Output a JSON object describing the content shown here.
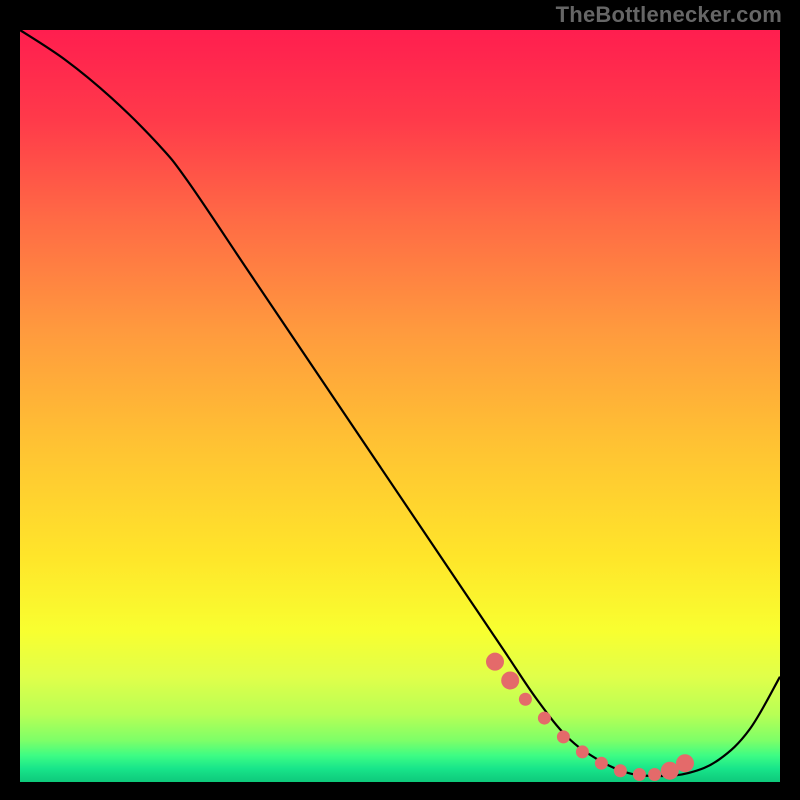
{
  "attribution": "TheBottlenecker.com",
  "chart_data": {
    "type": "line",
    "title": "",
    "xlabel": "",
    "ylabel": "",
    "xlim": [
      0,
      100
    ],
    "ylim": [
      0,
      100
    ],
    "series": [
      {
        "name": "curve",
        "x": [
          0,
          6,
          12,
          18,
          22,
          30,
          38,
          46,
          54,
          60,
          64,
          68,
          72,
          76,
          80,
          84,
          88,
          92,
          96,
          100
        ],
        "y": [
          100,
          96,
          91,
          85,
          80,
          68,
          56,
          44,
          32,
          23,
          17,
          11,
          6,
          3,
          1.2,
          0.8,
          1.2,
          3,
          7,
          14
        ]
      }
    ],
    "markers": {
      "x": [
        62.5,
        64.5,
        66.5,
        69,
        71.5,
        74,
        76.5,
        79,
        81.5,
        83.5,
        85.5,
        87.5
      ],
      "y": [
        16,
        13.5,
        11,
        8.5,
        6,
        4,
        2.5,
        1.5,
        1,
        1,
        1.5,
        2.5
      ],
      "big_indices": [
        0,
        1,
        10,
        11
      ]
    },
    "gradient_stops": [
      {
        "offset": 0,
        "color": "#ff1e4f"
      },
      {
        "offset": 0.12,
        "color": "#ff3a4a"
      },
      {
        "offset": 0.25,
        "color": "#ff6a45"
      },
      {
        "offset": 0.4,
        "color": "#ff9a3e"
      },
      {
        "offset": 0.55,
        "color": "#ffc233"
      },
      {
        "offset": 0.7,
        "color": "#ffe52a"
      },
      {
        "offset": 0.8,
        "color": "#f8ff30"
      },
      {
        "offset": 0.86,
        "color": "#e0ff4a"
      },
      {
        "offset": 0.91,
        "color": "#b8ff55"
      },
      {
        "offset": 0.945,
        "color": "#7dff68"
      },
      {
        "offset": 0.965,
        "color": "#3dfc84"
      },
      {
        "offset": 0.982,
        "color": "#18e58a"
      },
      {
        "offset": 1.0,
        "color": "#0ec97b"
      }
    ],
    "marker_color": "#e46a6a",
    "curve_color": "#000000"
  }
}
